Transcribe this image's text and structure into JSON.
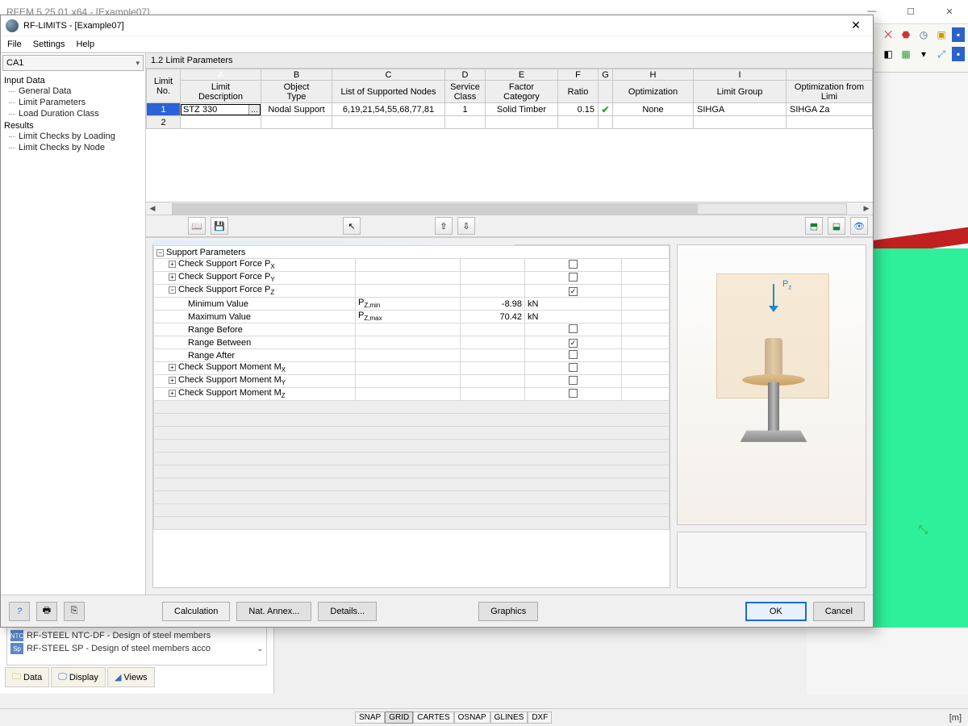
{
  "bg": {
    "title": "RFEM 5.25.01 x64 - [Example07]",
    "win_min": "—",
    "win_max": "☐",
    "win_close": "✕",
    "list_items": [
      {
        "icon": "NTC",
        "label": "RF-STEEL NTC-DF - Design of steel members"
      },
      {
        "icon": "Sp",
        "label": "RF-STEEL SP - Design of steel members acco"
      }
    ],
    "tabs": [
      "Data",
      "Display",
      "Views"
    ],
    "status_buttons": [
      "SNAP",
      "GRID",
      "CARTES",
      "OSNAP",
      "GLINES",
      "DXF"
    ],
    "status_right": "[m]"
  },
  "dlg": {
    "title": "RF-LIMITS - [Example07]",
    "menu": [
      "File",
      "Settings",
      "Help"
    ],
    "combo": "CA1",
    "tree": {
      "input": "Input Data",
      "input_items": [
        "General Data",
        "Limit Parameters",
        "Load Duration Class"
      ],
      "results": "Results",
      "results_items": [
        "Limit Checks by Loading",
        "Limit Checks by Node"
      ]
    },
    "panel_title": "1.2 Limit Parameters",
    "grid": {
      "letters": [
        "A",
        "B",
        "C",
        "D",
        "E",
        "F",
        "G",
        "H",
        "I"
      ],
      "headers": {
        "no": "Limit\nNo.",
        "A": "Limit\nDescription",
        "B": "Object\nType",
        "C": "List of Supported Nodes",
        "D": "Service\nClass",
        "E": "Factor\nCategory",
        "F": "Ratio",
        "G": "",
        "H": "Optimization",
        "I": "Limit Group",
        "J": "Optimization from\nLimi"
      },
      "row1": {
        "no": "1",
        "A": "STZ 330",
        "B": "Nodal Support",
        "C": "6,19,21,54,55,68,77,81",
        "D": "1",
        "E": "Solid Timber",
        "F": "0.15",
        "H": "None",
        "I": "SIHGA",
        "J": "SIHGA Za"
      },
      "row2_no": "2"
    },
    "params": {
      "header": "Support Parameters",
      "px": "Check Support Force P",
      "px_sub": "X",
      "py": "Check Support Force P",
      "py_sub": "Y",
      "pz": "Check Support Force P",
      "pz_sub": "Z",
      "min_label": "Minimum Value",
      "min_sym": "P",
      "min_sub": "Z,min",
      "min_val": "-8.98",
      "min_unit": "kN",
      "max_label": "Maximum Value",
      "max_sym": "P",
      "max_sub": "Z,max",
      "max_val": "70.42",
      "max_unit": "kN",
      "rb": "Range Before",
      "rbet": "Range Between",
      "ra": "Range After",
      "mx": "Check Support Moment M",
      "mx_sub": "X",
      "my": "Check Support Moment M",
      "my_sub": "Y",
      "mz": "Check Support Moment M",
      "mz_sub": "Z"
    },
    "preview_label": "P",
    "preview_sub": "z",
    "footer": {
      "calc": "Calculation",
      "annex": "Nat. Annex...",
      "details": "Details...",
      "graphics": "Graphics",
      "ok": "OK",
      "cancel": "Cancel",
      "help": "?"
    }
  }
}
